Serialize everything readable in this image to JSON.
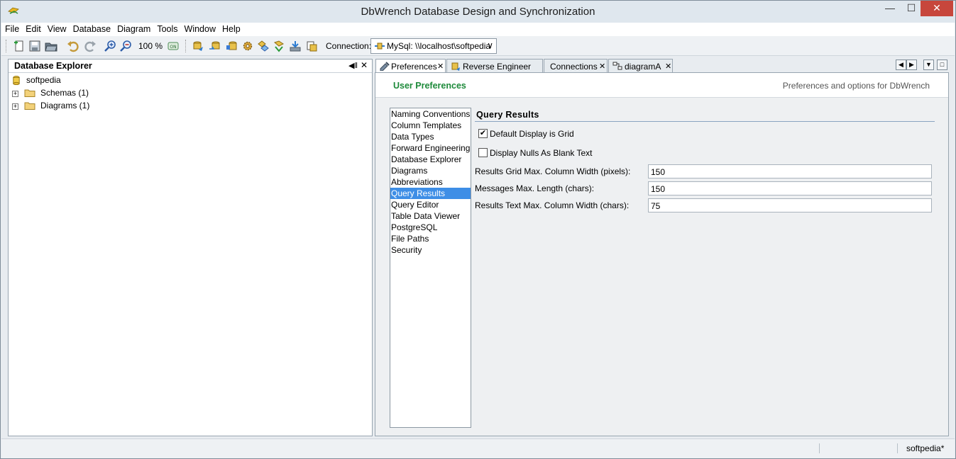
{
  "window": {
    "title": "DbWrench Database Design and Synchronization",
    "controls": {
      "minimize": "—",
      "maximize": "☐",
      "close": "✕"
    }
  },
  "menu": [
    "File",
    "Edit",
    "View",
    "Database",
    "Diagram",
    "Tools",
    "Window",
    "Help"
  ],
  "toolbar": {
    "zoom": "100 %",
    "connection_label": "Connection:",
    "connection_value": "MySql: \\\\localhost\\softpedia"
  },
  "explorer": {
    "title": "Database Explorer",
    "root": "softpedia",
    "nodes": [
      "Schemas (1)",
      "Diagrams (1)"
    ]
  },
  "tabs": [
    {
      "label": "Preferences"
    },
    {
      "label": "Reverse Engineer"
    },
    {
      "label": "Connections"
    },
    {
      "label": "diagramA"
    }
  ],
  "preferences": {
    "title": "User Preferences",
    "subtitle": "Preferences and options for DbWrench",
    "categories": [
      "Naming Conventions",
      "Column Templates",
      "Data Types",
      "Forward Engineering",
      "Database Explorer",
      "Diagrams",
      "Abbreviations",
      "Query Results",
      "Query Editor",
      "Table Data Viewer",
      "PostgreSQL",
      "File Paths",
      "Security"
    ],
    "selected_index": 7,
    "section_title": "Query Results",
    "checkboxes": [
      {
        "label": "Default Display is Grid",
        "checked": true
      },
      {
        "label": "Display Nulls As Blank Text",
        "checked": false
      }
    ],
    "fields": [
      {
        "label": "Results Grid Max. Column Width (pixels):",
        "value": "150"
      },
      {
        "label": "Messages Max. Length (chars):",
        "value": "150"
      },
      {
        "label": "Results Text Max. Column Width (chars):",
        "value": "75"
      }
    ]
  },
  "status": {
    "project": "softpedia*"
  }
}
